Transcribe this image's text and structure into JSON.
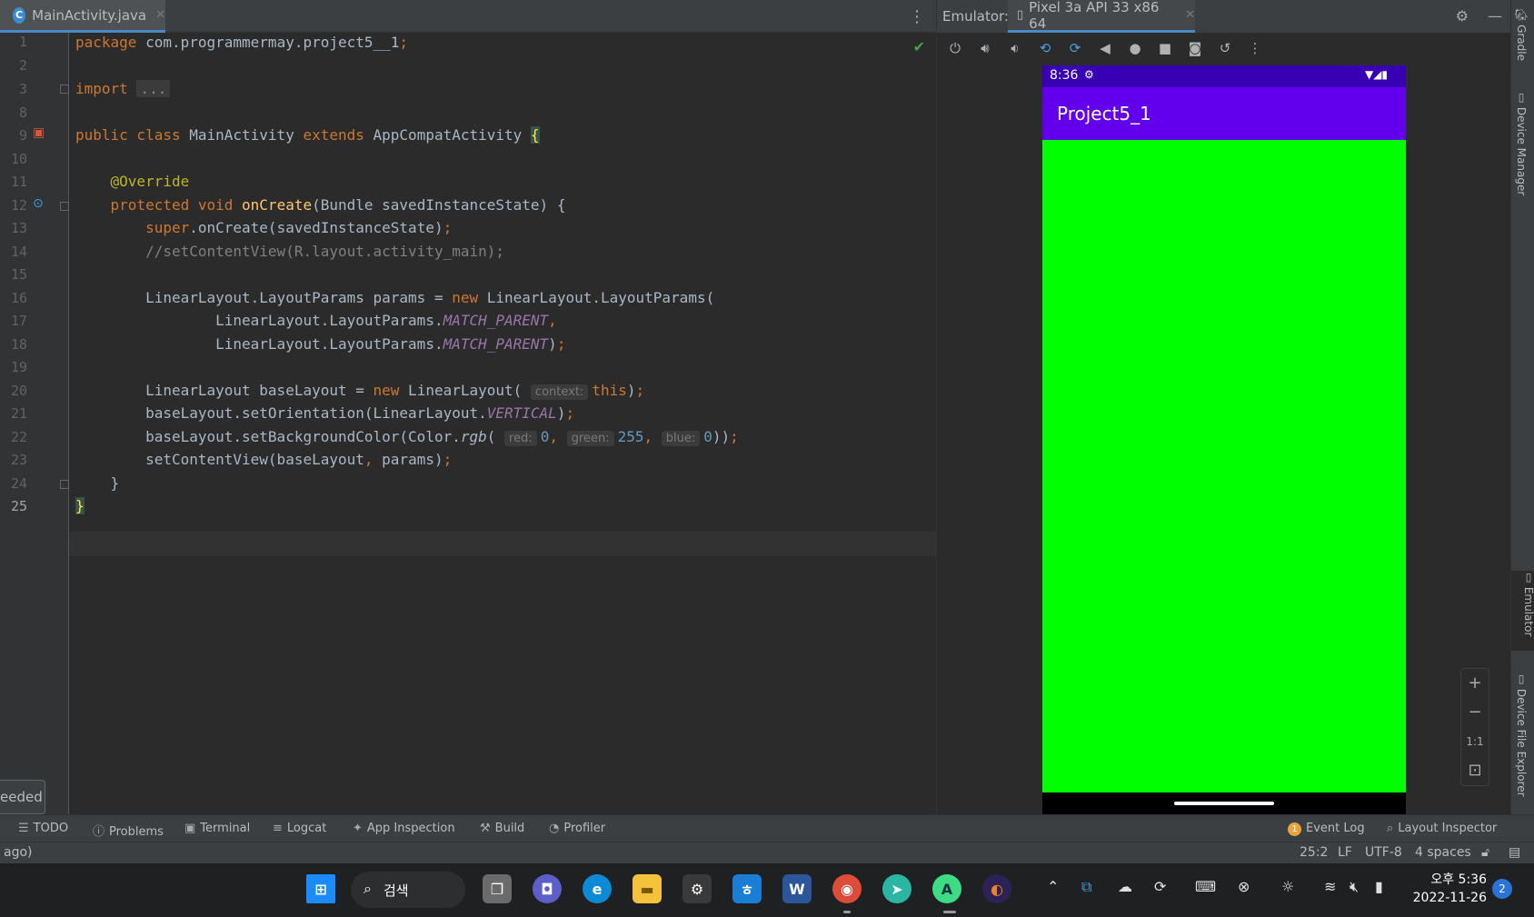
{
  "editor": {
    "tab_label": "MainActivity.java",
    "tab_icon_letter": "C",
    "line_numbers": [
      "1",
      "2",
      "3",
      "8",
      "9",
      "10",
      "11",
      "12",
      "13",
      "14",
      "15",
      "16",
      "17",
      "18",
      "19",
      "20",
      "21",
      "22",
      "23",
      "24",
      "25"
    ],
    "lines": {
      "l1_kw": "package",
      "l1_rest": " com.programmermay.project5__1",
      "l1_semi": ";",
      "l3_kw": "import",
      "l3_fold": "...",
      "l9_kw1": "public class",
      "l9_name": " MainActivity ",
      "l9_kw2": "extends",
      "l9_super": " AppCompatActivity ",
      "l9_brace": "{",
      "l11_ann": "@Override",
      "l12_kw": "protected void ",
      "l12_fn": "onCreate",
      "l12_rest": "(Bundle savedInstanceState) {",
      "l13_kw": "super",
      "l13_rest": ".onCreate(savedInstanceState)",
      "l13_semi": ";",
      "l14_cm": "//setContentView(R.layout.activity_main);",
      "l16_a": "LinearLayout.LayoutParams params = ",
      "l16_kw": "new",
      "l16_b": " LinearLayout.LayoutParams(",
      "l17_a": "LinearLayout.LayoutParams.",
      "l17_st": "MATCH_PARENT",
      "l17_c": ",",
      "l18_a": "LinearLayout.LayoutParams.",
      "l18_st": "MATCH_PARENT",
      "l18_b": ")",
      "l18_semi": ";",
      "l20_a": "LinearLayout baseLayout = ",
      "l20_kw": "new",
      "l20_b": " LinearLayout(",
      "l20_hint": "context:",
      "l20_this": "this",
      "l20_c": ")",
      "l20_semi": ";",
      "l21_a": "baseLayout.setOrientation(LinearLayout.",
      "l21_st": "VERTICAL",
      "l21_b": ")",
      "l21_semi": ";",
      "l22_a": "baseLayout.setBackgroundColor(Color.",
      "l22_it": "rgb",
      "l22_b": "(",
      "l22_h1": "red:",
      "l22_v1": "0",
      "l22_c1": ", ",
      "l22_h2": "green:",
      "l22_v2": "255",
      "l22_c2": ", ",
      "l22_h3": "blue:",
      "l22_v3": "0",
      "l22_e": "))",
      "l22_semi": ";",
      "l23_a": "setContentView(baseLayout",
      "l23_comma": ",",
      "l23_b": " params)",
      "l23_semi": ";",
      "l24": "}",
      "l25": "}"
    },
    "toast_text": "eeded"
  },
  "emulator": {
    "label": "Emulator:",
    "device_tab": "Pixel 3a API 33 x86 64",
    "phone": {
      "time": "8:36",
      "app_title": "Project5_1",
      "background_color": "#00ff00",
      "appbar_color": "#6200ee",
      "statusbar_color": "#3700b3"
    },
    "zoom": {
      "plus": "+",
      "minus": "−",
      "one_to_one": "1:1",
      "fit": "⊡"
    }
  },
  "right_strip": {
    "gradle": "Gradle",
    "device_manager": "Device Manager",
    "emulator": "Emulator",
    "device_file_explorer": "Device File Explorer"
  },
  "bottom_tools": {
    "todo": "TODO",
    "problems": "Problems",
    "terminal": "Terminal",
    "logcat": "Logcat",
    "app_inspection": "App Inspection",
    "build": "Build",
    "profiler": "Profiler",
    "event_log": "Event Log",
    "event_count": "1",
    "layout_inspector": "Layout Inspector"
  },
  "status_bar": {
    "left": "ago)",
    "position": "25:2",
    "line_sep": "LF",
    "encoding": "UTF-8",
    "indent": "4 spaces"
  },
  "taskbar": {
    "search_label": "검색",
    "clock_time": "오후 5:36",
    "clock_date": "2022-11-26",
    "notification_count": "2"
  }
}
